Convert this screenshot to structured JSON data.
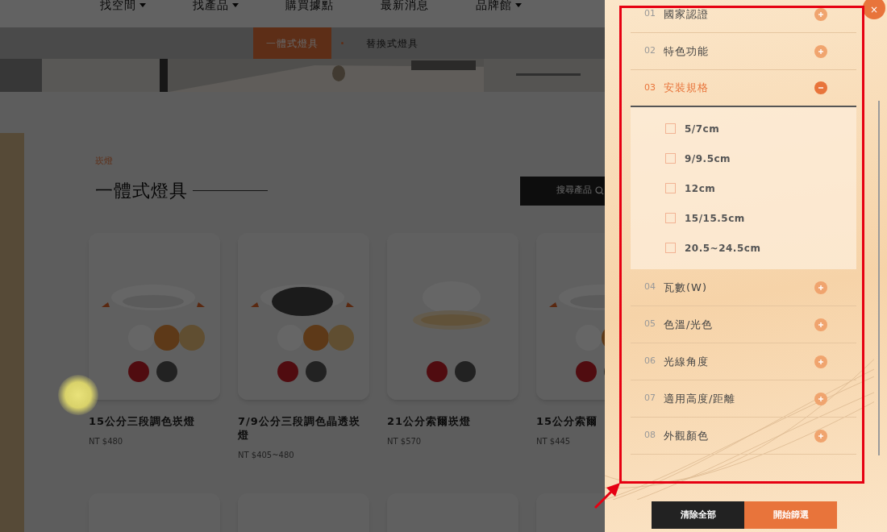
{
  "nav": [
    {
      "label": "找空間",
      "dropdown": true
    },
    {
      "label": "找產品",
      "dropdown": true
    },
    {
      "label": "購買據點",
      "dropdown": false
    },
    {
      "label": "最新消息",
      "dropdown": false
    },
    {
      "label": "品牌館",
      "dropdown": true
    }
  ],
  "subnav": [
    {
      "label": "一體式燈具",
      "selected": true
    },
    {
      "label": "替換式燈具",
      "selected": false
    }
  ],
  "breadcrumb": "崁燈",
  "heading": "一體式燈具",
  "search_button": "搜尋產品",
  "products": [
    {
      "name": "15公分三段調色崁燈",
      "price": "NT $480"
    },
    {
      "name": "7/9公分三段調色晶透崁燈",
      "price": "NT $405~480"
    },
    {
      "name": "21公分索爾崁燈",
      "price": "NT $570"
    },
    {
      "name": "15公分索爾",
      "price": "NT $445"
    }
  ],
  "filter": {
    "close": "×",
    "groups": [
      {
        "number": "01",
        "label": "國家認證",
        "expanded": false
      },
      {
        "number": "02",
        "label": "特色功能",
        "expanded": false
      },
      {
        "number": "03",
        "label": "安裝規格",
        "expanded": true,
        "options": [
          {
            "label": "5/7cm",
            "checked": false
          },
          {
            "label": "9/9.5cm",
            "checked": false
          },
          {
            "label": "12cm",
            "checked": false
          },
          {
            "label": "15/15.5cm",
            "checked": false
          },
          {
            "label": "20.5~24.5cm",
            "checked": false
          }
        ]
      },
      {
        "number": "04",
        "label": "瓦數(W)",
        "expanded": false
      },
      {
        "number": "05",
        "label": "色溫/光色",
        "expanded": false
      },
      {
        "number": "06",
        "label": "光線角度",
        "expanded": false
      },
      {
        "number": "07",
        "label": "適用高度/距離",
        "expanded": false
      },
      {
        "number": "08",
        "label": "外觀顏色",
        "expanded": false
      }
    ],
    "buttons": [
      {
        "label": "清除全部",
        "kind": "clear"
      },
      {
        "label": "開始篩選",
        "kind": "apply"
      }
    ]
  }
}
